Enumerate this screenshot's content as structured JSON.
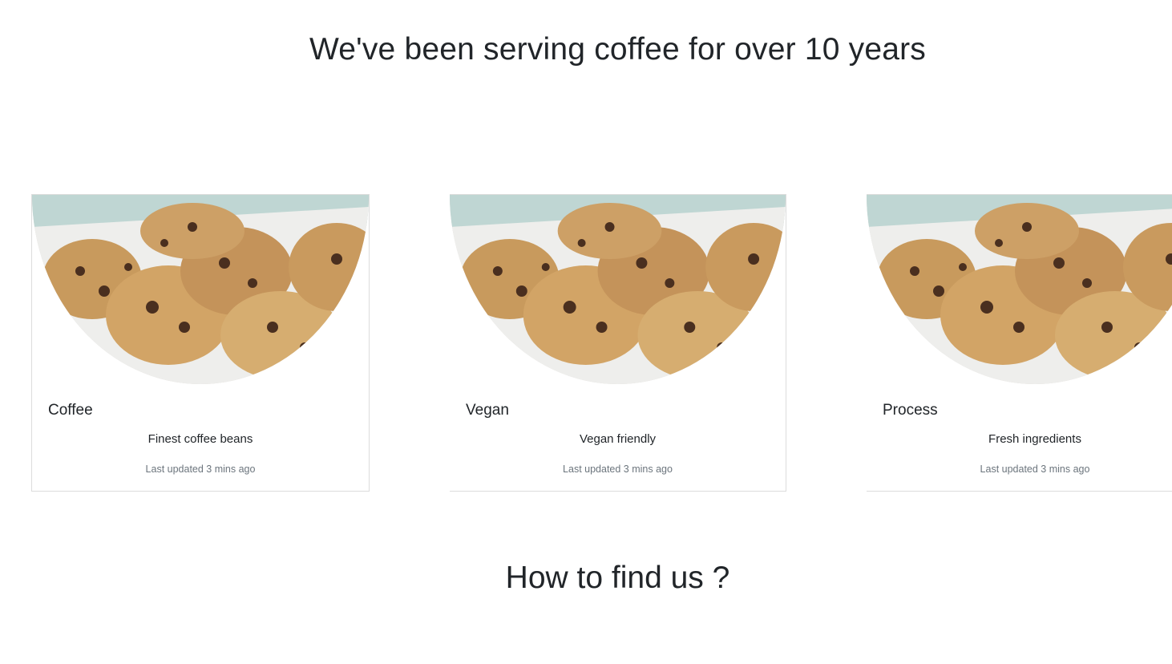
{
  "section": {
    "heading": "We've been serving coffee for over 10 years"
  },
  "cards": [
    {
      "image_icon": "cookies-image",
      "title": "Coffee",
      "text": "Finest coffee beans",
      "meta": "Last updated 3 mins ago"
    },
    {
      "image_icon": "cookies-image",
      "title": "Vegan",
      "text": "Vegan friendly",
      "meta": "Last updated 3 mins ago"
    },
    {
      "image_icon": "cookies-image",
      "title": "Process",
      "text": "Fresh ingredients",
      "meta": "Last updated 3 mins ago"
    }
  ],
  "find_us": {
    "heading": "How to find us ?"
  },
  "colors": {
    "text": "#212529",
    "muted": "#6c757d",
    "border": "#dcdcdc"
  }
}
